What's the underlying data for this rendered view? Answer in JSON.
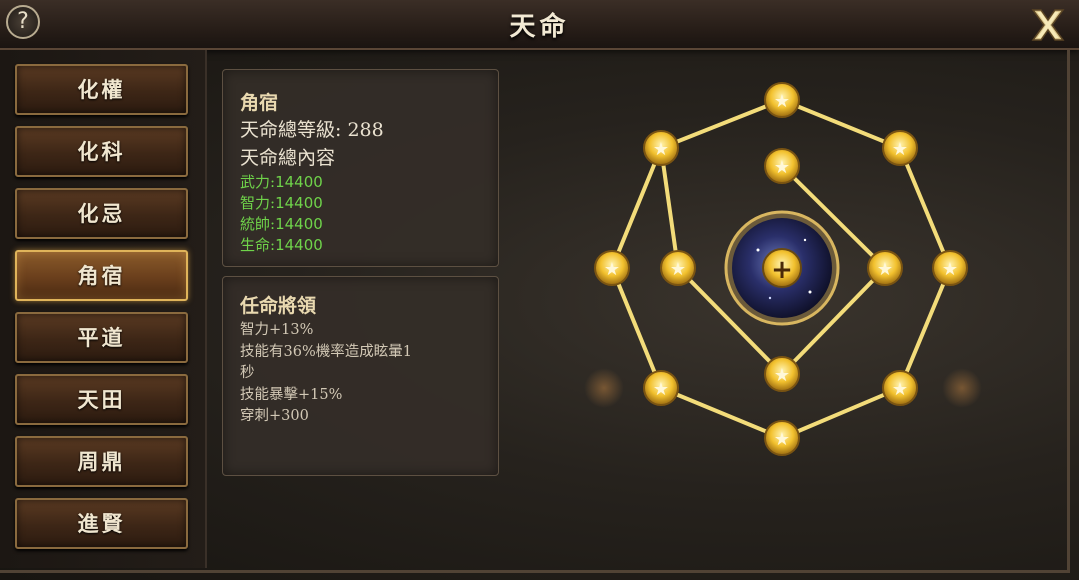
{
  "window": {
    "title": "天命",
    "help_symbol": "?"
  },
  "sidebar": {
    "items": [
      {
        "label": "化權",
        "active": false
      },
      {
        "label": "化科",
        "active": false
      },
      {
        "label": "化忌",
        "active": false
      },
      {
        "label": "角宿",
        "active": true
      },
      {
        "label": "平道",
        "active": false
      },
      {
        "label": "天田",
        "active": false
      },
      {
        "label": "周鼎",
        "active": false
      },
      {
        "label": "進賢",
        "active": false
      }
    ]
  },
  "info": {
    "name": "角宿",
    "level_label": "天命總等級:",
    "level_value": "288",
    "content_label": "天命總內容",
    "stats": [
      {
        "label": "武力:",
        "value": "14400"
      },
      {
        "label": "智力:",
        "value": "14400"
      },
      {
        "label": "統帥:",
        "value": "14400"
      },
      {
        "label": "生命:",
        "value": "14400"
      }
    ]
  },
  "appoint": {
    "title": "任命將領",
    "lines": [
      "智力+13%",
      "技能有36%機率造成眩暈1",
      "秒",
      "技能暴擊+15%",
      "穿刺+300"
    ]
  },
  "diagram": {
    "center_symbol": "+",
    "node_symbol": "★",
    "line_color": "#f3dc7a",
    "node_color": "#f2c12e"
  }
}
